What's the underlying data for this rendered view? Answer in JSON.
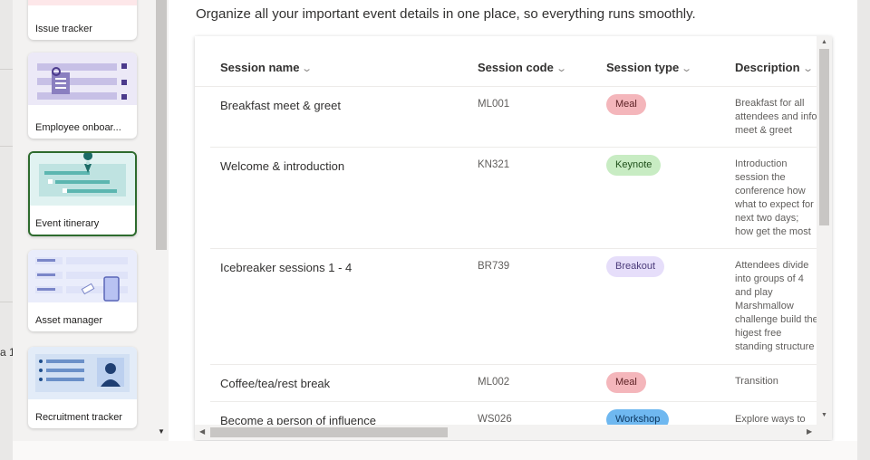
{
  "intro_text": "Organize all your important event details in one place, so everything runs smoothly.",
  "backdrop_fragment": "a 1",
  "templates": [
    {
      "label": "Issue tracker",
      "icon": "issue-tracker-thumbnail"
    },
    {
      "label": "Employee onboar...",
      "icon": "employee-onboarding-thumbnail"
    },
    {
      "label": "Event itinerary",
      "icon": "event-itinerary-thumbnail",
      "selected": true
    },
    {
      "label": "Asset manager",
      "icon": "asset-manager-thumbnail"
    },
    {
      "label": "Recruitment tracker",
      "icon": "recruitment-tracker-thumbnail"
    }
  ],
  "grid": {
    "columns": [
      "Session name",
      "Session code",
      "Session type",
      "Description"
    ],
    "rows": [
      {
        "name": "Breakfast meet & greet",
        "code": "ML001",
        "type": "Meal",
        "description": "Breakfast for all attendees and info meet & greet"
      },
      {
        "name": "Welcome & introduction",
        "code": "KN321",
        "type": "Keynote",
        "description": "Introduction session the conference how what to expect for next two days; how get the most of the conference"
      },
      {
        "name": "Icebreaker sessions 1 - 4",
        "code": "BR739",
        "type": "Breakout",
        "description": "Attendees divide into groups of 4 and play Marshmallow challenge build the higest free standing structure tape, sphagetti and marshmallow. Go!"
      },
      {
        "name": "Coffee/tea/rest break",
        "code": "ML002",
        "type": "Meal",
        "description": "Transition"
      },
      {
        "name": "Become a person of influence",
        "code": "WS026",
        "type": "Workshop",
        "description": "Explore ways to"
      }
    ]
  },
  "colors": {
    "meal": "#f4b6bb",
    "keynote": "#c8ecc3",
    "breakout": "#e6defa",
    "workshop": "#6fb8f0",
    "selected_border": "#2e6b2e"
  }
}
